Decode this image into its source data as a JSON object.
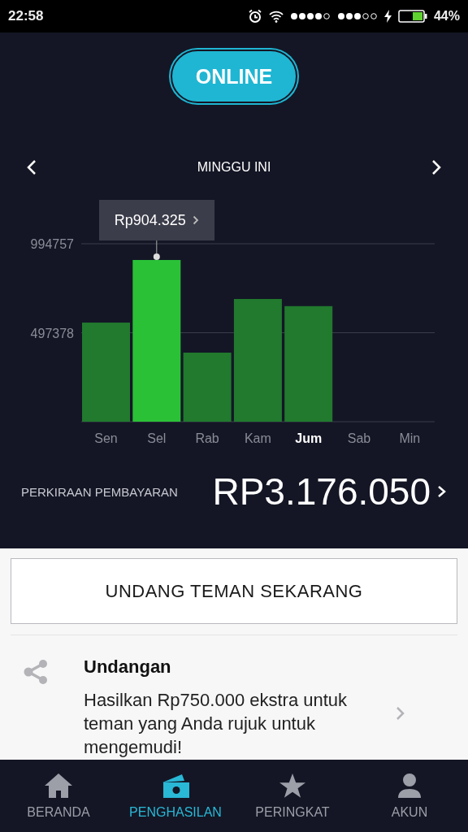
{
  "status_bar": {
    "time": "22:58",
    "battery": "44%"
  },
  "online_button": {
    "label": "ONLINE"
  },
  "week_nav": {
    "title": "MINGGU INI"
  },
  "chart": {
    "tooltip": "Rp904.325",
    "days": [
      {
        "selected": false,
        "today": false
      },
      {
        "selected": true,
        "today": false
      },
      {
        "selected": false,
        "today": false
      },
      {
        "selected": false,
        "today": false
      },
      {
        "selected": false,
        "today": true
      },
      {
        "selected": false,
        "today": false
      },
      {
        "selected": false,
        "today": false
      }
    ],
    "chart_data": {
      "type": "bar",
      "categories": [
        "Sen",
        "Sel",
        "Rab",
        "Kam",
        "Jum",
        "Sab",
        "Min"
      ],
      "series": [
        {
          "values": [
            554000,
            904000,
            386000,
            686000,
            646000,
            null,
            null
          ]
        }
      ],
      "ylim": [
        0,
        994757
      ],
      "yticks": [
        497378,
        994757
      ]
    }
  },
  "estimate": {
    "label": "PERKIRAAN PEMBAYARAN",
    "amount": "RP3.176.050"
  },
  "invite_button": {
    "label": "UNDANG TEMAN SEKARANG"
  },
  "invite_card": {
    "title": "Undangan",
    "text": "Hasilkan Rp750.000 ekstra untuk teman yang Anda rujuk untuk mengemudi!"
  },
  "tabs": [
    {
      "label": "BERANDA",
      "kind": "home",
      "selected": false
    },
    {
      "label": "PENGHASILAN",
      "kind": "money",
      "selected": true
    },
    {
      "label": "PERINGKAT",
      "kind": "star",
      "selected": false
    },
    {
      "label": "AKUN",
      "kind": "person",
      "selected": false
    }
  ]
}
